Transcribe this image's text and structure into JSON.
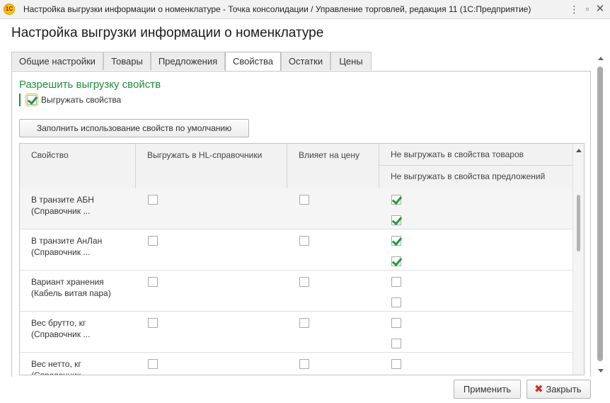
{
  "window": {
    "title": "Настройка выгрузки информации о номенклатуре - Точка консолидации / Управление торговлей, редакция 11  (1С:Предприятие)",
    "app_icon_text": "1С"
  },
  "form": {
    "title": "Настройка выгрузки информации о номенклатуре"
  },
  "tabs": [
    {
      "label": "Общие настройки"
    },
    {
      "label": "Товары"
    },
    {
      "label": "Предложения"
    },
    {
      "label": "Свойства",
      "active": true
    },
    {
      "label": "Остатки"
    },
    {
      "label": "Цены"
    }
  ],
  "properties_tab": {
    "section_title": "Разрешить выгрузку свойств",
    "export_properties_label": "Выгружать свойства",
    "export_properties_checked": true,
    "fill_defaults_button": "Заполнить использование свойств по умолчанию"
  },
  "table": {
    "columns": {
      "property": "Свойство",
      "export_hl": "Выгружать в HL-справочники",
      "affects_price": "Влияет на цену",
      "no_export_products": "Не выгружать в свойства товаров",
      "no_export_offers": "Не выгружать в свойства предложений"
    },
    "rows": [
      {
        "name_line1": "В транзите АБН",
        "name_line2": "(Справочник ...",
        "export_hl": false,
        "affects_price": false,
        "no_export_products": true,
        "no_export_offers": true,
        "selected": true
      },
      {
        "name_line1": "В транзите АнЛан",
        "name_line2": "(Справочник ...",
        "export_hl": false,
        "affects_price": false,
        "no_export_products": true,
        "no_export_offers": true,
        "selected": false
      },
      {
        "name_line1": "Вариант хранения",
        "name_line2": "(Кабель витая пара)",
        "export_hl": false,
        "affects_price": false,
        "no_export_products": false,
        "no_export_offers": false,
        "selected": false
      },
      {
        "name_line1": "Вес брутто, кг",
        "name_line2": "(Справочник ...",
        "export_hl": false,
        "affects_price": false,
        "no_export_products": false,
        "no_export_offers": false,
        "selected": false
      },
      {
        "name_line1": "Вес нетто, кг",
        "name_line2": "(Справочник ...",
        "export_hl": false,
        "affects_price": false,
        "no_export_products": false,
        "no_export_offers": false,
        "selected": false
      }
    ]
  },
  "footer": {
    "apply_button": "Применить",
    "close_button": "Закрыть"
  },
  "colors": {
    "accent_green": "#1e8f3a",
    "check_green": "#1f9a3c",
    "close_red": "#d62b2b"
  }
}
